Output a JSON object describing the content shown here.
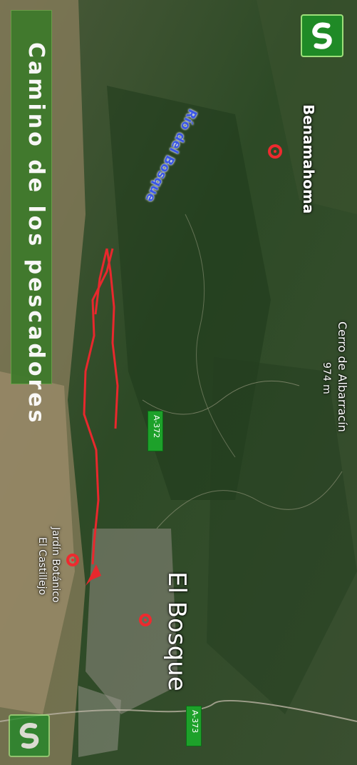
{
  "title": "Camino de los pescadores",
  "places": {
    "benamahoma": "Benamahoma",
    "cerro_name": "Cerro de Albarracín",
    "cerro_height": "974 m",
    "el_bosque": "El Bosque",
    "jardin_line1": "Jardín Botánico",
    "jardin_line2": "El Castillejo",
    "river": "Río del Bosque"
  },
  "roads": {
    "a372": "A-372",
    "a373": "A-373"
  },
  "colors": {
    "route": "#e8282d",
    "marker": "#ee2a2f",
    "river_label": "#3b57e6",
    "road_sign": "#1da12a",
    "title_bg": "#3f7a2c"
  },
  "icons": [
    "logo-icon",
    "location-marker-icon",
    "arrow-icon"
  ]
}
